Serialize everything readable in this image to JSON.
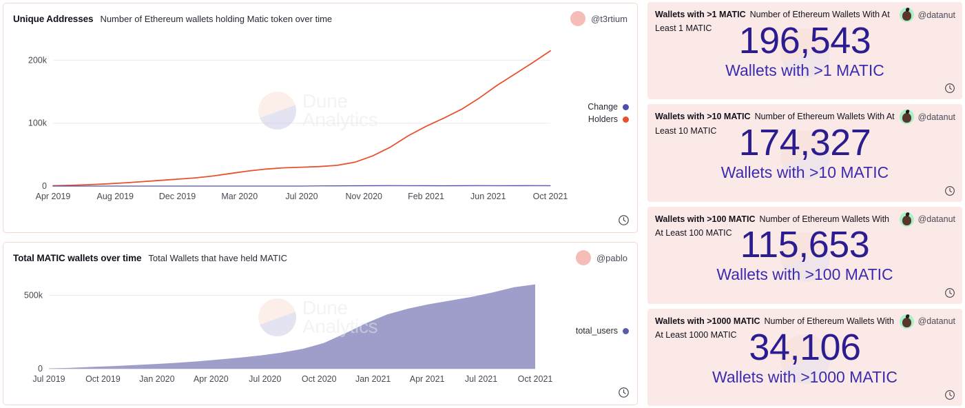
{
  "left_panels": [
    {
      "title": "Unique Addresses",
      "subtitle": "Number of Ethereum wallets holding Matic token over time",
      "handle": "@t3rtium",
      "avatar_icon": "avatar-circle",
      "clock_icon": "clock-icon",
      "watermark": "Dune Analytics",
      "watermark_line1": "Dune",
      "watermark_line2": "Analytics",
      "legend": [
        {
          "label": "Change",
          "color": "#4d4fa8"
        },
        {
          "label": "Holders",
          "color": "#e8502e"
        }
      ]
    },
    {
      "title": "Total MATIC wallets over time",
      "subtitle": "Total Wallets that have held MATIC",
      "handle": "@pablo",
      "avatar_icon": "avatar-circle",
      "clock_icon": "clock-icon",
      "watermark": "Dune Analytics",
      "watermark_line1": "Dune",
      "watermark_line2": "Analytics",
      "legend": [
        {
          "label": "total_users",
          "color": "#5d5ca8"
        }
      ]
    }
  ],
  "chart_data": [
    {
      "type": "line",
      "title": "Unique Addresses",
      "subtitle": "Number of Ethereum wallets holding Matic token over time",
      "xlabel": "",
      "ylabel": "",
      "grid": true,
      "legend_position": "right",
      "ylim": [
        0,
        230000
      ],
      "yticks": [
        0,
        100000,
        200000
      ],
      "ytick_labels": [
        "0",
        "100k",
        "200k"
      ],
      "x": [
        "Apr 2019",
        "Aug 2019",
        "Dec 2019",
        "Mar 2020",
        "Jul 2020",
        "Nov 2020",
        "Feb 2021",
        "Jun 2021",
        "Oct 2021"
      ],
      "xtick_labels": [
        "Apr 2019",
        "Aug 2019",
        "Dec 2019",
        "Mar 2020",
        "Jul 2020",
        "Nov 2020",
        "Feb 2021",
        "Jun 2021",
        "Oct 2021"
      ],
      "series": [
        {
          "name": "Holders",
          "color": "#e8502e",
          "values": [
            500,
            1200,
            2200,
            3500,
            5000,
            7000,
            9000,
            11000,
            13000,
            16000,
            20000,
            24000,
            27000,
            29000,
            30000,
            31000,
            33000,
            38000,
            48000,
            62000,
            80000,
            95000,
            108000,
            122000,
            140000,
            160000,
            178000,
            196000,
            215000
          ]
        },
        {
          "name": "Change",
          "color": "#4d4fa8",
          "values": [
            0,
            0,
            0,
            0,
            0,
            0,
            0,
            0,
            0,
            0,
            0,
            0,
            0,
            0,
            0,
            300,
            400,
            500,
            700,
            900,
            800,
            700,
            600,
            700,
            900,
            800,
            700,
            900,
            800
          ]
        }
      ]
    },
    {
      "type": "area",
      "title": "Total MATIC wallets over time",
      "subtitle": "Total Wallets that have held MATIC",
      "xlabel": "",
      "ylabel": "",
      "grid": true,
      "legend_position": "right",
      "ylim": [
        0,
        620000
      ],
      "yticks": [
        0,
        500000
      ],
      "ytick_labels": [
        "0",
        "500k"
      ],
      "x": [
        "Jul 2019",
        "Oct 2019",
        "Jan 2020",
        "Apr 2020",
        "Jul 2020",
        "Oct 2020",
        "Jan 2021",
        "Apr 2021",
        "Jul 2021",
        "Oct 2021"
      ],
      "xtick_labels": [
        "Jul 2019",
        "Oct 2019",
        "Jan 2020",
        "Apr 2020",
        "Jul 2020",
        "Oct 2020",
        "Jan 2021",
        "Apr 2021",
        "Jul 2021",
        "Oct 2021"
      ],
      "series": [
        {
          "name": "total_users",
          "color": "#9a99c8",
          "values": [
            2000,
            6000,
            12000,
            18000,
            25000,
            32000,
            40000,
            50000,
            62000,
            75000,
            90000,
            110000,
            135000,
            175000,
            240000,
            310000,
            370000,
            410000,
            440000,
            465000,
            490000,
            520000,
            555000,
            575000
          ]
        }
      ]
    }
  ],
  "cards": [
    {
      "title": "Wallets with >1 MATIC",
      "subtitle": "Number of Ethereum Wallets With At Least 1 MATIC",
      "value": "196,543",
      "caption": "Wallets with >1 MATIC",
      "handle": "@datanut",
      "avatar_icon": "datanut-avatar-icon",
      "clock_icon": "clock-icon"
    },
    {
      "title": "Wallets with >10 MATIC",
      "subtitle": "Number of Ethereum Wallets With At Least 10 MATIC",
      "value": "174,327",
      "caption": "Wallets with >10 MATIC",
      "handle": "@datanut",
      "avatar_icon": "datanut-avatar-icon",
      "clock_icon": "clock-icon"
    },
    {
      "title": "Wallets with >100 MATIC",
      "subtitle": "Number of Ethereum Wallets With At Least 100 MATIC",
      "value": "115,653",
      "caption": "Wallets with >100 MATIC",
      "handle": "@datanut",
      "avatar_icon": "datanut-avatar-icon",
      "clock_icon": "clock-icon"
    },
    {
      "title": "Wallets with >1000 MATIC",
      "subtitle": "Number of Ethereum Wallets With At Least 1000 MATIC",
      "value": "34,106",
      "caption": "Wallets with >1000 MATIC",
      "handle": "@datanut",
      "avatar_icon": "datanut-avatar-icon",
      "clock_icon": "clock-icon"
    }
  ],
  "colors": {
    "card_bg": "#fbe9e7",
    "panel_border": "#f3d9d2",
    "holders": "#e8502e",
    "change": "#4d4fa8",
    "total_users": "#9a99c8",
    "big_number": "#2b1d8f"
  }
}
